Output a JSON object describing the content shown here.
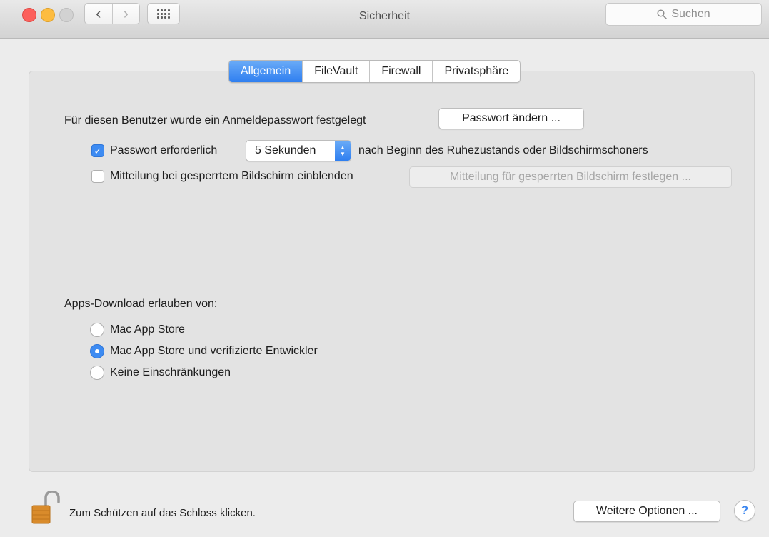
{
  "window": {
    "title": "Sicherheit",
    "search_placeholder": "Suchen",
    "nav": {
      "back_symbol": "‹",
      "forward_symbol": "›"
    }
  },
  "tabs": [
    {
      "label": "Allgemein",
      "active": true
    },
    {
      "label": "FileVault",
      "active": false
    },
    {
      "label": "Firewall",
      "active": false
    },
    {
      "label": "Privatsphäre",
      "active": false
    }
  ],
  "general": {
    "password_set_text": "Für diesen Benutzer wurde ein Anmeldepasswort festgelegt",
    "change_password_button": "Passwort ändern ...",
    "require_password": {
      "checked": true,
      "label": "Passwort erforderlich"
    },
    "delay_select_value": "5 Sekunden",
    "after_text": "nach Beginn des Ruhezustands oder Bildschirmschoners",
    "lock_message": {
      "checked": false,
      "label": "Mitteilung bei gesperrtem Bildschirm einblenden"
    },
    "set_message_button": "Mitteilung für gesperrten Bildschirm festlegen ..."
  },
  "downloads": {
    "heading": "Apps-Download erlauben von:",
    "options": [
      {
        "label": "Mac App Store",
        "selected": false
      },
      {
        "label": "Mac App Store und verifizierte Entwickler",
        "selected": true
      },
      {
        "label": "Keine Einschränkungen",
        "selected": false
      }
    ]
  },
  "footer": {
    "lock_text": "Zum Schützen auf das Schloss klicken.",
    "advanced_button": "Weitere Optionen ...",
    "help_label": "?"
  },
  "icons": {
    "lock": "open-padlock-icon",
    "search": "magnifier-icon",
    "grid": "show-all-grid-icon"
  },
  "colors": {
    "accent": "#3d8bf2",
    "close": "#fc605c",
    "minimize": "#fdbc40",
    "zoom_inactive": "#d2d2d2"
  }
}
